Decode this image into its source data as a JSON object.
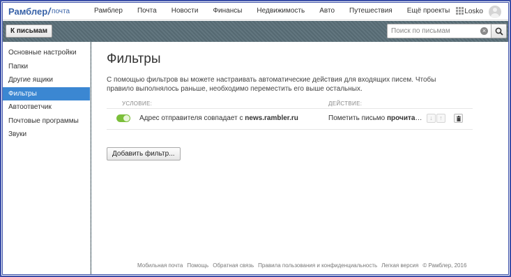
{
  "header": {
    "logo_main": "Рамблер",
    "logo_sub": "почта",
    "nav": [
      "Рамблер",
      "Почта",
      "Новости",
      "Финансы",
      "Недвижимость",
      "Авто",
      "Путешествия",
      "Ещё проекты"
    ],
    "user_name": "Losko"
  },
  "toolbar": {
    "back_label": "К письмам",
    "search_placeholder": "Поиск по письмам",
    "clear_glyph": "×"
  },
  "sidebar": {
    "items": [
      {
        "label": "Основные настройки"
      },
      {
        "label": "Папки"
      },
      {
        "label": "Другие ящики"
      },
      {
        "label": "Фильтры",
        "active": true
      },
      {
        "label": "Автоответчик"
      },
      {
        "label": "Почтовые программы"
      },
      {
        "label": "Звуки"
      }
    ]
  },
  "main": {
    "title": "Фильтры",
    "description": "С помощью фильтров вы можете настраивать автоматические действия для входящих писем. Чтобы правило выполнялось раньше, необходимо переместить его выше остальных.",
    "columns": {
      "condition": "Условие:",
      "action": "Действие:"
    },
    "filters": [
      {
        "enabled": true,
        "condition_prefix": "Адрес отправителя совпадает с ",
        "condition_value": "news.rambler.ru",
        "action_prefix": "Пометить письмо ",
        "action_value": "прочитанным"
      }
    ],
    "arrow_down": "↓",
    "arrow_up": "↑",
    "add_button": "Добавить фильтр..."
  },
  "footer": {
    "links": [
      "Мобильная почта",
      "Помощь",
      "Обратная связь",
      "Правила пользования и конфиденциальность",
      "Легкая версия"
    ],
    "copyright": "© Рамблер, 2016"
  },
  "colors": {
    "accent": "#3b87d2",
    "brand": "#3762a8",
    "toggle_on": "#7bbf3a",
    "toolbar_bg": "#5a6f78"
  }
}
